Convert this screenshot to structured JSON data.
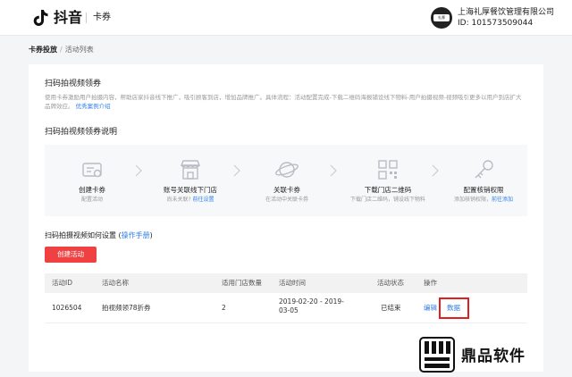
{
  "header": {
    "app_name": "抖音",
    "product": "卡券",
    "company": "上海礼厚餐饮管理有限公司",
    "account_id": "ID: 101573509044",
    "avatar_text": "礼厚"
  },
  "breadcrumb": {
    "first": "卡券投放",
    "sep": "/",
    "current": "活动列表"
  },
  "intro": {
    "title": "扫码拍视频领券",
    "description": "使用卡券激励用户拍摄内容，帮助店家抖音线下推广，吸引顾客到店，增加品牌推广。具体流程：活动配置完成-下载二维码海报铺设线下物料-用户拍摄视频-视频吸引更多以用户到店扩大品牌效应。",
    "link": "优秀案例介绍"
  },
  "steps_title": "扫码拍视频领券说明",
  "steps": [
    {
      "title": "创建卡券",
      "sub": "配置活动",
      "sub_link": ""
    },
    {
      "title": "账号关联线下门店",
      "sub": "尚未关联?",
      "sub_link": "前往设置"
    },
    {
      "title": "关联卡券",
      "sub": "在活动中关联卡券",
      "sub_link": ""
    },
    {
      "title": "下载门店二维码",
      "sub": "下载门店二维码，铺设线下物料",
      "sub_link": ""
    },
    {
      "title": "配置核销权限",
      "sub": "添加核销权限，",
      "sub_link": "前往添加"
    }
  ],
  "howto": {
    "text": "扫码拍摄视频如何设置",
    "link": "操作手册"
  },
  "create_button": "创建活动",
  "table": {
    "headers": [
      "活动ID",
      "活动名称",
      "适用门店数量",
      "活动时间",
      "活动状态",
      "操作"
    ],
    "rows": [
      {
        "id": "1026504",
        "name": "拍视频领78折券",
        "stores": "2",
        "time": "2019-02-20 - 2019-03-05",
        "status": "已结束",
        "edit": "编辑",
        "data": "数据"
      }
    ]
  },
  "watermark": "鼎品软件",
  "colors": {
    "accent": "#2f7ee6",
    "primary_button": "#f04142",
    "highlight": "#e02020"
  }
}
